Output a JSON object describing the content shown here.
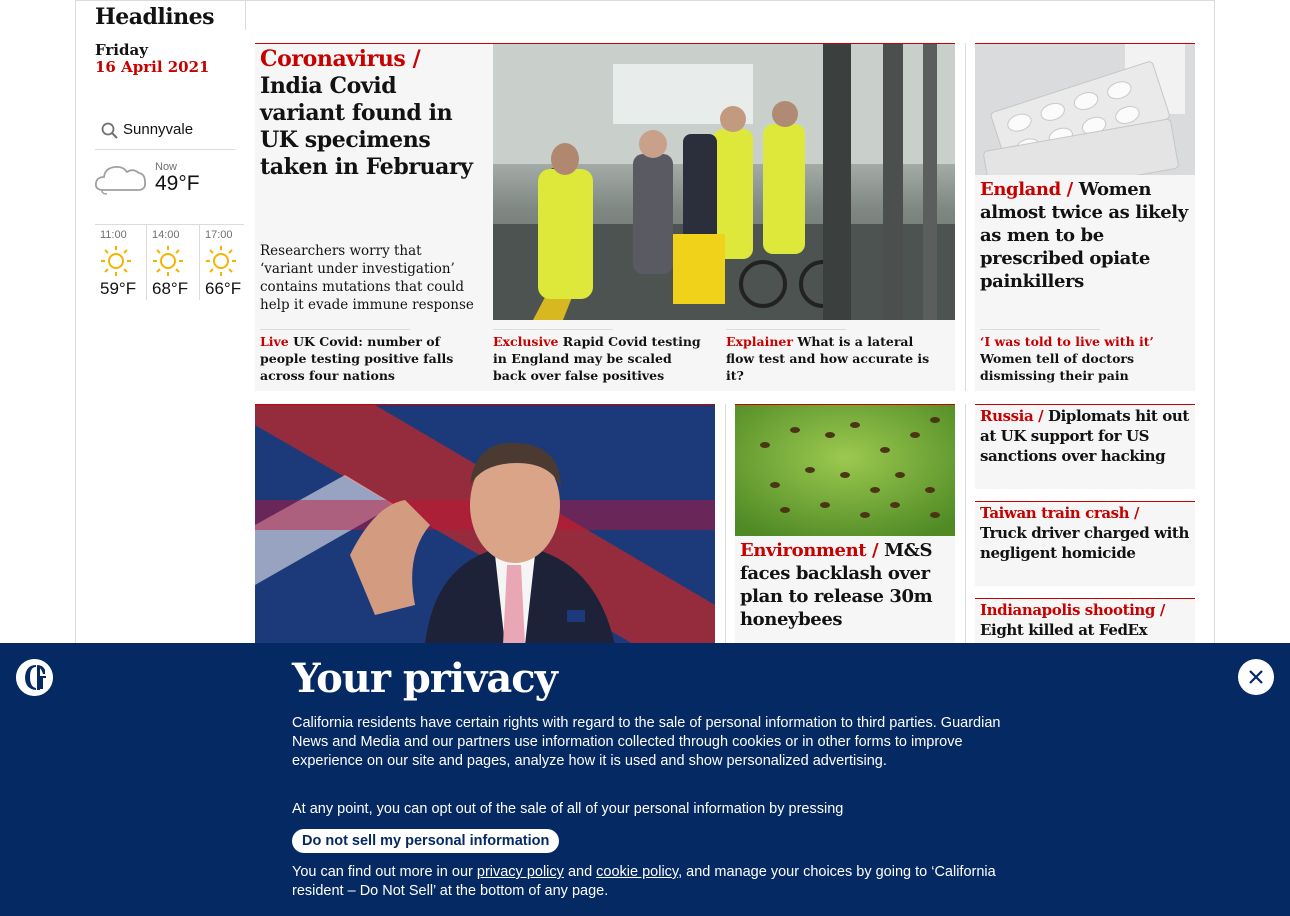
{
  "section": {
    "title": "Headlines",
    "day": "Friday",
    "date": "16 April 2021"
  },
  "weather": {
    "location": "Sunnyvale",
    "now_label": "Now",
    "now_temp": "49°F",
    "now_icon": "cloud-icon",
    "forecast": [
      {
        "time": "11:00",
        "temp": "59°F",
        "icon": "sun-icon"
      },
      {
        "time": "14:00",
        "temp": "68°F",
        "icon": "sun-icon"
      },
      {
        "time": "17:00",
        "temp": "66°F",
        "icon": "sun-icon"
      }
    ]
  },
  "main_story": {
    "kicker": "Coronavirus /",
    "headline": "India Covid variant found in UK specimens taken in February",
    "standfirst": "Researchers worry that ‘variant under investigation’ contains mutations that could help it evade immune response",
    "subs": [
      {
        "kicker": "Live",
        "text": "UK Covid: number of people testing positive falls across four nations"
      },
      {
        "kicker": "Exclusive",
        "text": "Rapid Covid testing in England may be scaled back over false positives"
      },
      {
        "kicker": "Explainer",
        "text": "What is a lateral flow test and how accurate is it?"
      }
    ]
  },
  "side_story": {
    "kicker": "England /",
    "headline": "Women almost twice as likely as men to be prescribed opiate painkillers",
    "sub_kicker": "‘I was told to live with it’",
    "sub_text": "Women tell of doctors dismissing their pain"
  },
  "environment_story": {
    "kicker": "Environment /",
    "headline": "M&S faces backlash over plan to release 30m honeybees"
  },
  "small_stories": [
    {
      "kicker": "Russia /",
      "headline": "Diplomats hit out at UK support for US sanctions over hacking"
    },
    {
      "kicker": "Taiwan train crash /",
      "headline": "Truck driver charged with negligent homicide"
    },
    {
      "kicker": "Indianapolis shooting /",
      "headline": "Eight killed at FedEx"
    }
  ],
  "privacy": {
    "title": "Your privacy",
    "para1": "California residents have certain rights with regard to the sale of personal information to third parties. Guardian News and Media and our partners use information collected through cookies or in other forms to improve experience on our site and pages, analyze how it is used and show personalized advertising.",
    "para2": "At any point, you can opt out of the sale of all of your personal information by pressing",
    "button": "Do not sell my personal information",
    "para3_a": "You can find out more in our",
    "privacy_link": "privacy policy",
    "and": "and",
    "cookie_link": "cookie policy",
    "para3_b": ", and manage your choices by going to ‘California resident – Do Not Sell’ at the bottom of any page."
  },
  "colors": {
    "accent": "#c70000",
    "banner": "#052962"
  }
}
